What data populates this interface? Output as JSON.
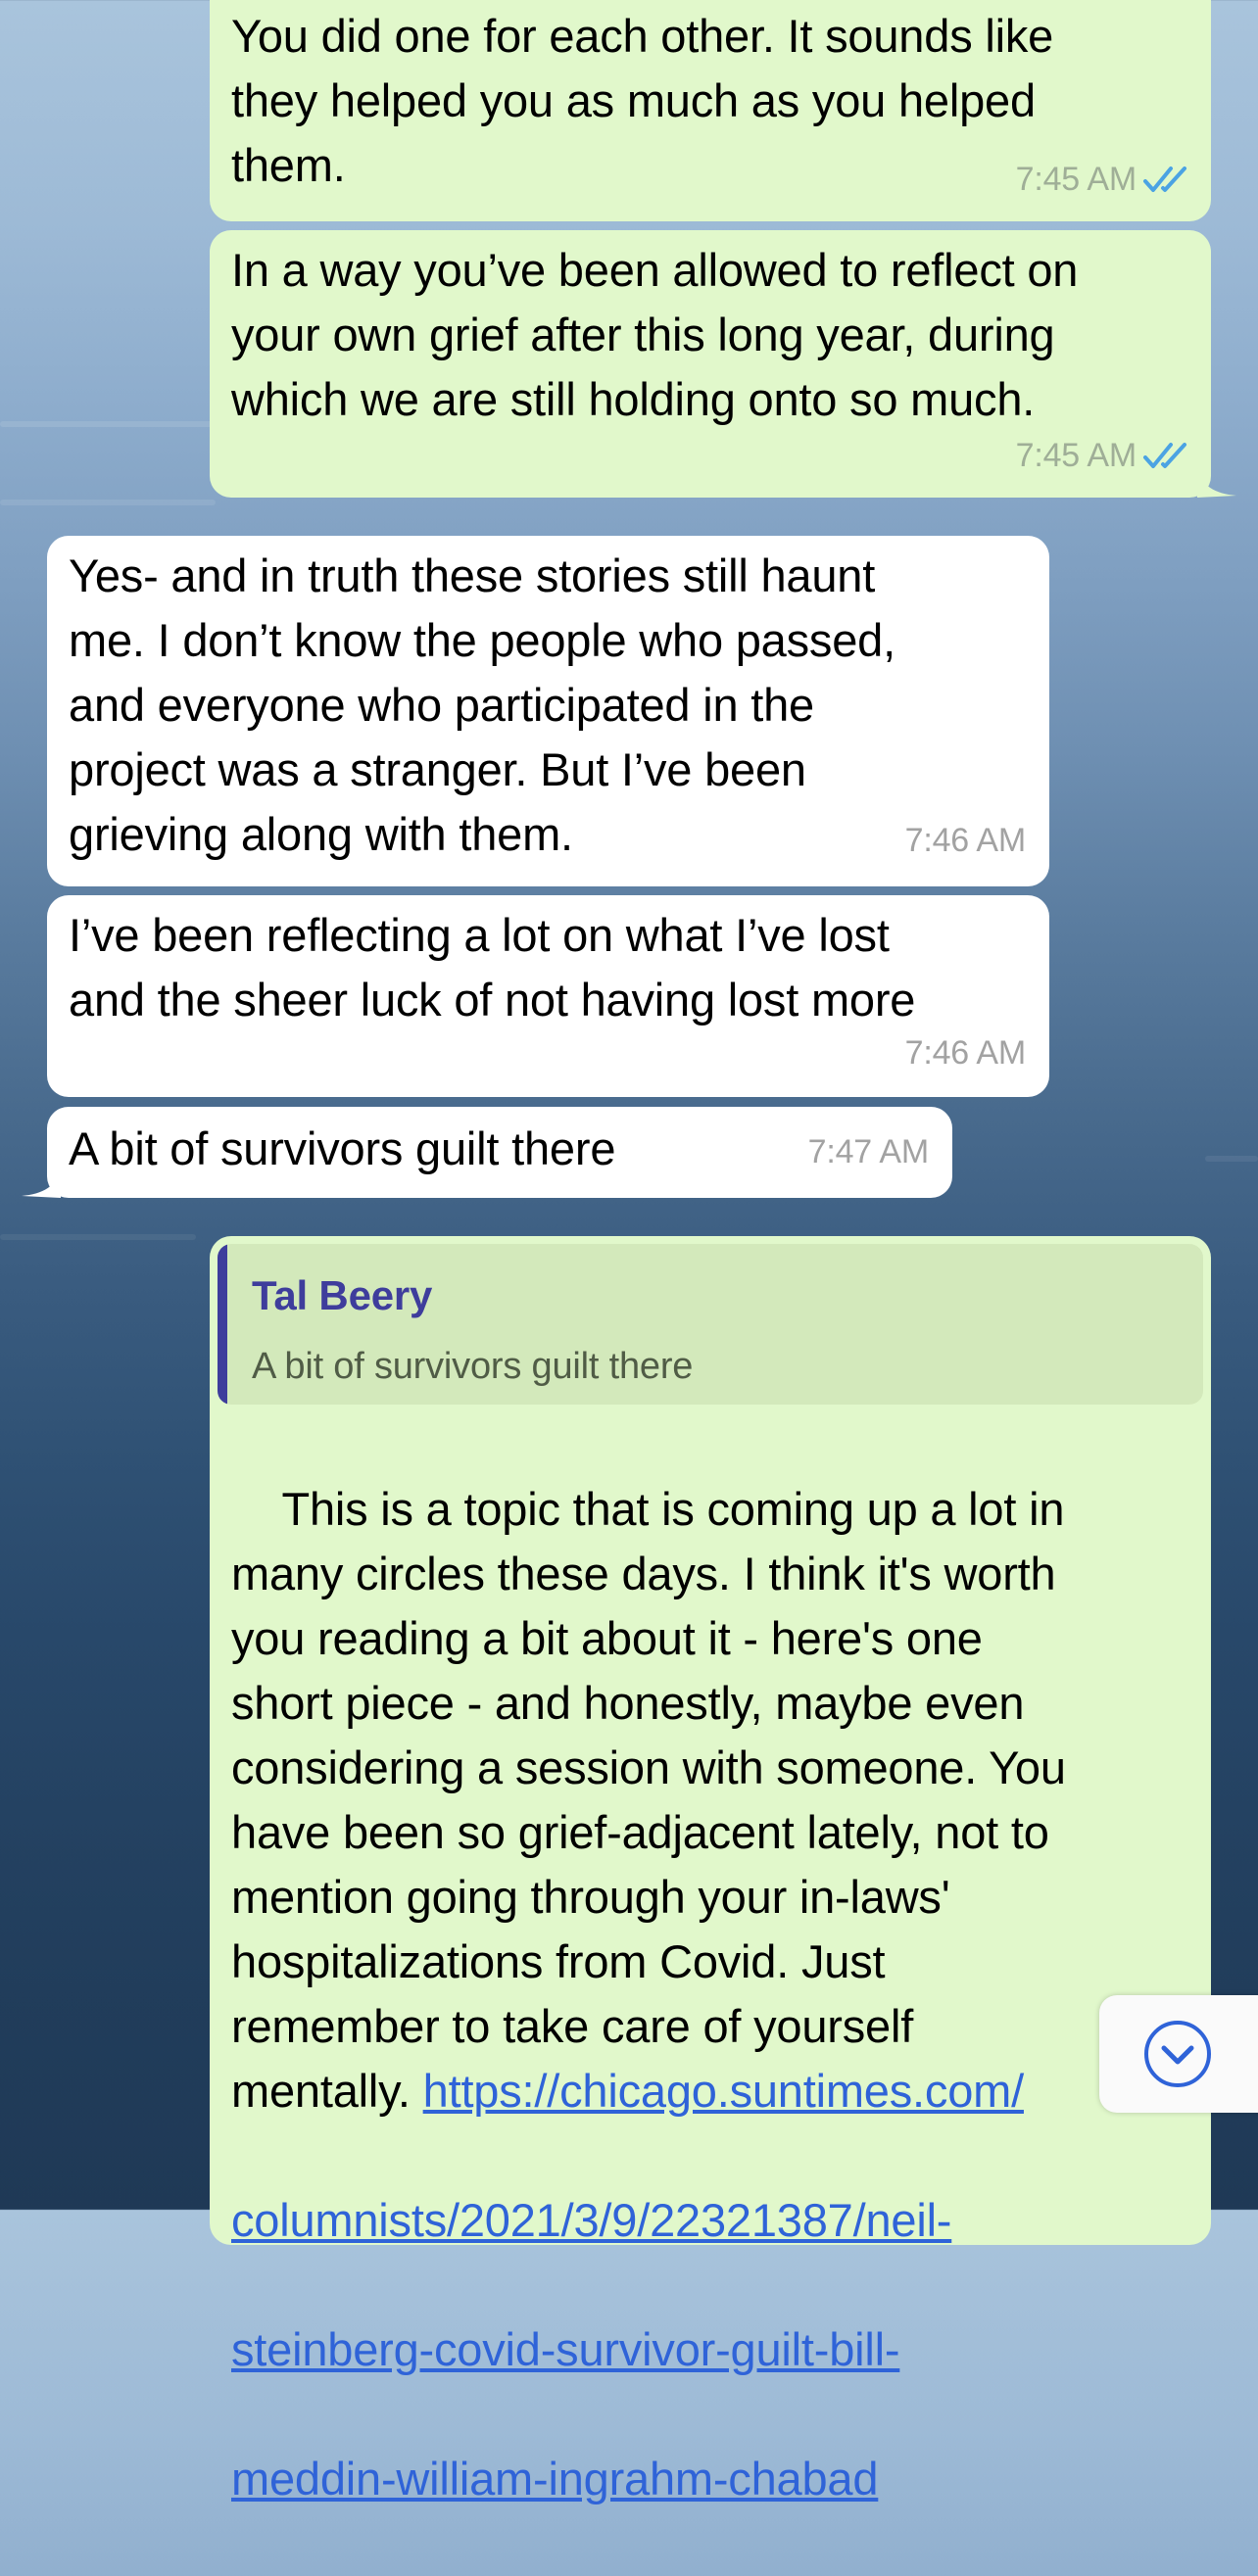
{
  "messages": [
    {
      "text": "You did one for each other. It sounds like\nthey helped you as much as you helped\nthem.",
      "time": "7:45 AM"
    },
    {
      "text": "In a way you’ve been allowed to reflect on\nyour own grief after this long year, during\nwhich we are still holding onto so much.",
      "time": "7:45 AM"
    },
    {
      "text": "Yes- and in truth these stories still haunt\nme. I don’t know the people who passed,\nand everyone who participated in the\nproject was a stranger. But I’ve been\ngrieving along with them.",
      "time": "7:46 AM"
    },
    {
      "text": "I’ve been reflecting a lot on what I’ve lost\nand the sheer luck of not having lost more",
      "time": "7:46 AM"
    },
    {
      "text": "A bit of survivors guilt there",
      "time": "7:47 AM"
    },
    {
      "reply_to": {
        "name": "Tal Beery",
        "text": "A bit of survivors guilt there"
      },
      "text": "This is a topic that is coming up a lot in\nmany circles these days. I think it's worth\nyou reading a bit about it - here's one\nshort piece - and honestly, maybe even\nconsidering a session with someone. You\nhave been so grief-adjacent lately, not to\nmention going through your in-laws'\nhospitalizations from Covid. Just\nremember to take care of yourself\nmentally. ",
      "link_lines": [
        "https://chicago.suntimes.com/",
        "columnists/2021/3/9/22321387/neil-",
        "steinberg-covid-survivor-guilt-bill-",
        "meddin-william-ingrahm-chabad"
      ]
    }
  ],
  "icons": {
    "read_receipt": "double-check-icon",
    "scroll_down": "chevron-down-circle-icon"
  },
  "colors": {
    "outgoing": "#e1f8cb",
    "incoming": "#ffffff",
    "accent": "#3e3d9c",
    "link": "#2f63d8",
    "ticks": "#4ba3e3"
  }
}
